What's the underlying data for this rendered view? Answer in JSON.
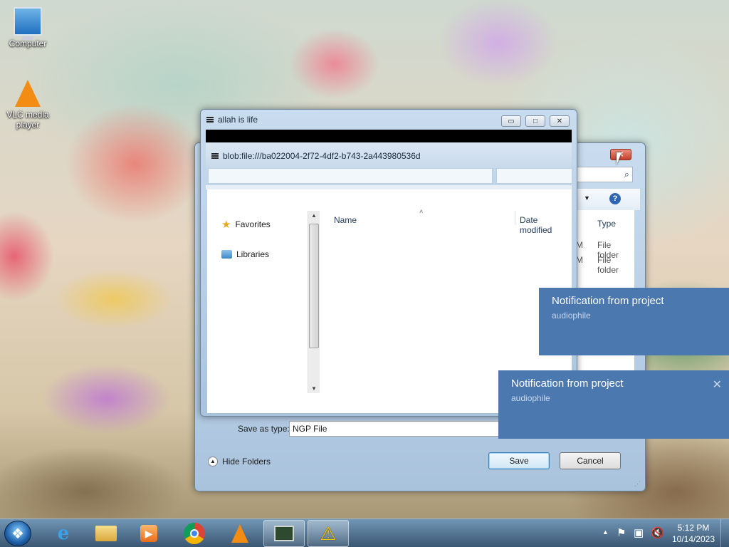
{
  "desktop": {
    "icons": [
      {
        "label": "Computer"
      },
      {
        "label": "VLC media player"
      }
    ]
  },
  "back_window": {
    "title": "allah is life",
    "minimize": "▭",
    "maximize": "□",
    "close": "✕"
  },
  "dialog": {
    "title": "blob:file:///ba022004-2f72-4df2-b743-2a443980536d",
    "close": "✕",
    "sidebar": {
      "items": [
        {
          "label": "Favorites"
        },
        {
          "label": "Libraries"
        }
      ]
    },
    "columns": {
      "name": "Name",
      "date_modified": "Date modified",
      "type": "Type"
    },
    "rows": [
      {
        "date_fragment": "M",
        "type": "File folder"
      },
      {
        "date_fragment": "M",
        "type": "File folder"
      }
    ],
    "save_as_type_label": "Save as type:",
    "save_as_type_value": "NGP File",
    "hide_folders": "Hide Folders",
    "save": "Save",
    "cancel": "Cancel",
    "help": "?"
  },
  "notifications": [
    {
      "title": "Notification from project",
      "subtitle": "audiophile"
    },
    {
      "title": "Notification from project",
      "subtitle": "audiophile",
      "close": "✕"
    }
  ],
  "taskbar": {
    "time": "5:12 PM",
    "date": "10/14/2023"
  },
  "colors": {
    "toast": "#4c78b0",
    "taskbar": "#375573"
  }
}
